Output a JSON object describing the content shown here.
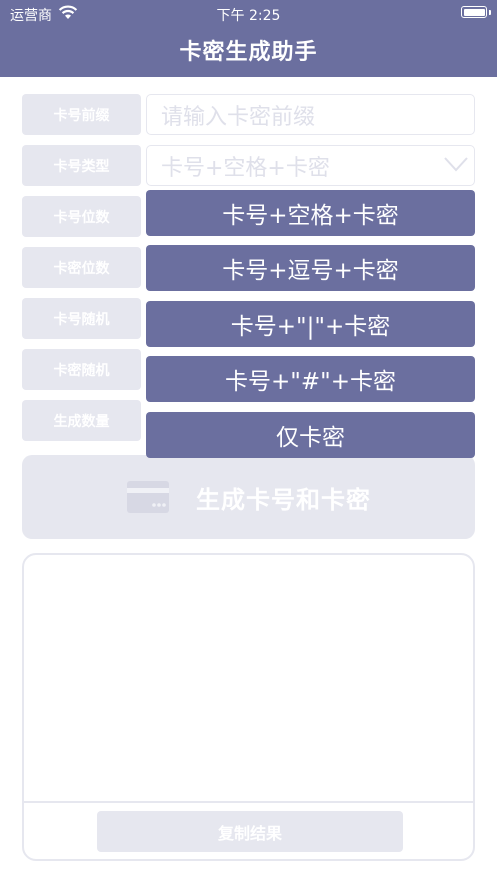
{
  "status_bar": {
    "carrier": "运营商",
    "time": "下午 2:25"
  },
  "nav": {
    "title": "卡密生成助手"
  },
  "form": {
    "rows": [
      {
        "label": "卡号前缀",
        "placeholder": "请输入卡密前缀"
      },
      {
        "label": "卡号类型",
        "value": "卡号+空格+卡密"
      },
      {
        "label": "卡号位数"
      },
      {
        "label": "卡密位数"
      },
      {
        "label": "卡号随机"
      },
      {
        "label": "卡密随机"
      },
      {
        "label": "生成数量"
      }
    ]
  },
  "dropdown": {
    "options": [
      "卡号+空格+卡密",
      "卡号+逗号+卡密",
      "卡号+\"|\"+卡密",
      "卡号+\"#\"+卡密",
      "仅卡密"
    ]
  },
  "generate_button": {
    "label": "生成卡号和卡密",
    "icon": "card-icon"
  },
  "result": {
    "text": "",
    "copy_label": "复制结果"
  },
  "colors": {
    "primary": "#6b6f9f",
    "disabled": "#e6e7ef",
    "placeholder": "#dfe0ea"
  }
}
